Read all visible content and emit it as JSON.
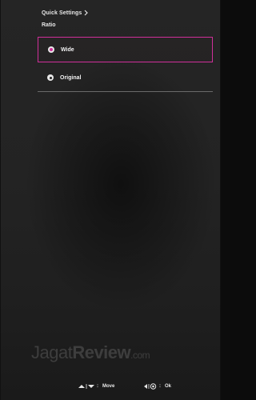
{
  "header": {
    "breadcrumb": "Quick Settings",
    "section_title": "Ratio"
  },
  "options": [
    {
      "label": "Wide",
      "selected": true
    },
    {
      "label": "Original",
      "selected": false
    }
  ],
  "footer": {
    "move_label": "Move",
    "ok_label": "Ok"
  },
  "watermark": {
    "part1": "Jagat",
    "part2": "Review",
    "part3": ".com"
  },
  "colors": {
    "accent": "#d02f9a",
    "text": "#e6e6e6",
    "background": "#232323"
  }
}
